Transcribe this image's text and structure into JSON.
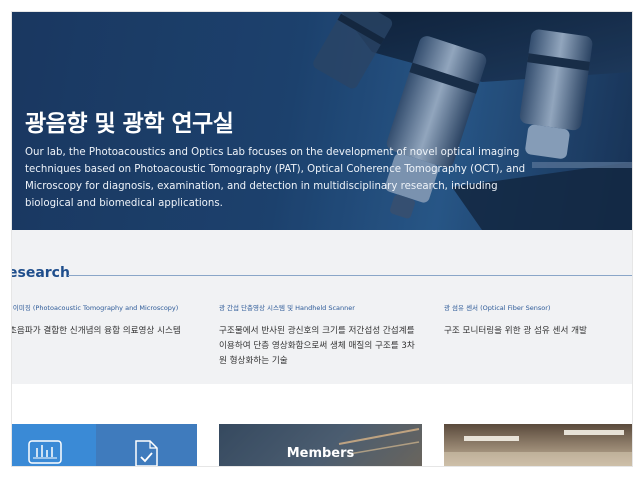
{
  "hero": {
    "title": "광음향 및 광학 연구실",
    "description": "Our lab, the Photoacoustics and Optics Lab focuses on the development of novel optical imaging techniques based on Photoacoustic Tomography (PAT), Optical Coherence Tomography (OCT), and Microscopy for diagnosis, examination, and detection in multidisciplinary research, including biological and biomedical applications."
  },
  "research": {
    "title": "esearch",
    "items": [
      {
        "category": "l 이미징 (Photoacoustic Tomography and Microscopy)",
        "description": "초음파가 결합한 신개념의 융합 의료영상 시스템"
      },
      {
        "category": "광 간섭 단층영상 시스템 및 Handheld Scanner",
        "description": "구조물에서 반사된 광신호의 크기를 저간섭성 간섭계를 이용하여 단층 영상화함으로써 생체 매질의 구조를 3차원 형상화하는 기술"
      },
      {
        "category": "광 섬유 센서 (Optical Fiber Sensor)",
        "description": "구조 모니터링을 위한 광 섬유 센서 개발"
      }
    ]
  },
  "cards": {
    "members_label": "Members"
  },
  "icons": [
    "bar-chart-icon",
    "document-check-icon"
  ]
}
